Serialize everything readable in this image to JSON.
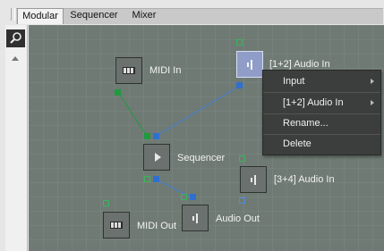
{
  "tabs": [
    "Modular",
    "Sequencer",
    "Mixer"
  ],
  "active_tab": "Modular",
  "nodes": {
    "midi_in": "MIDI In",
    "audio_in_12": "[1+2] Audio In",
    "sequencer": "Sequencer",
    "audio_in_34": "[3+4] Audio In",
    "midi_out": "MIDI Out",
    "audio_out": "Audio Out"
  },
  "context_menu": {
    "items": [
      "Input",
      "[1+2] Audio In",
      "Rename...",
      "Delete"
    ]
  },
  "icons": {
    "search": "search-icon",
    "piano": "piano-keys-icon",
    "audio": "speaker-icon",
    "play": "play-icon"
  },
  "colors": {
    "canvas": "#6f7a74",
    "midi_wire": "#1f9a40",
    "audio_wire": "#2f6fd0",
    "selected_node": "#8f9dc8"
  }
}
